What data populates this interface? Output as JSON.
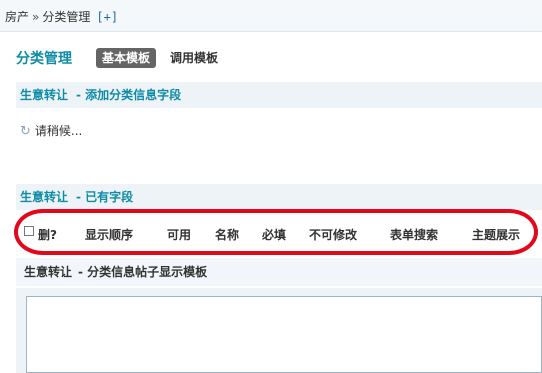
{
  "breadcrumb": {
    "root": "房产",
    "separator": "»",
    "current": "分类管理",
    "add": "[+]"
  },
  "page": {
    "title": "分类管理"
  },
  "tabs": [
    {
      "label": "基本模板",
      "active": true
    },
    {
      "label": "调用模板",
      "active": false
    }
  ],
  "section_add": {
    "name": "生意转让",
    "subtitle": "- 添加分类信息字段"
  },
  "loading": {
    "text": "请稍候..."
  },
  "section_fields": {
    "name": "生意转让",
    "subtitle": "- 已有字段"
  },
  "columns": {
    "delete": "删?",
    "order": "显示顺序",
    "enabled": "可用",
    "name": "名称",
    "required": "必填",
    "readonly": "不可修改",
    "search": "表单搜索",
    "topic": "主题展示"
  },
  "template": {
    "name": "生意转让",
    "subtitle": "- 分类信息帖子显示模板"
  },
  "colors": {
    "accent": "#0e8ca6",
    "highlight": "#e1081b",
    "tab_active_bg": "#656565"
  },
  "icons": {
    "loading": "refresh-icon"
  }
}
